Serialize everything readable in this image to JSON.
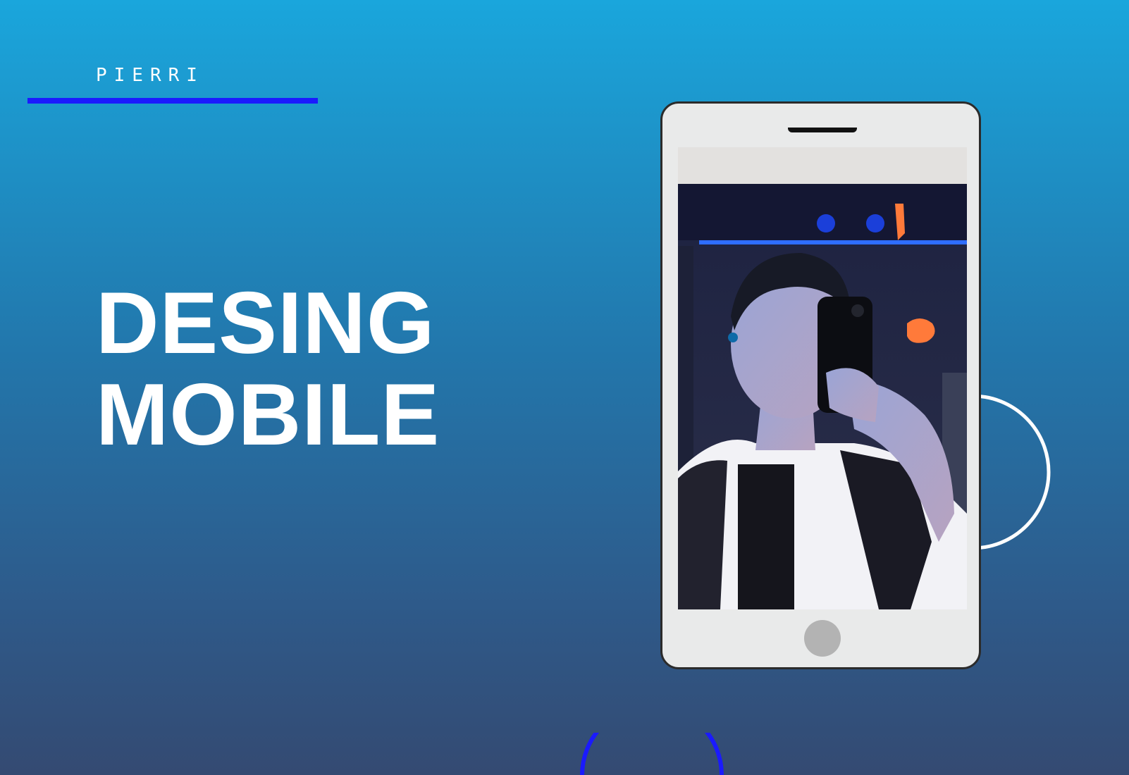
{
  "brand": {
    "name": "PIERRI"
  },
  "headline": {
    "line1": "DESING",
    "line2": "MOBILE"
  },
  "colors": {
    "accent": "#1a1aff",
    "background_top": "#1aa6dc",
    "background_bottom": "#344a72",
    "text": "#ffffff",
    "phone_body": "#e9eaea"
  },
  "phone": {
    "screen_image": "selfie-photo"
  }
}
